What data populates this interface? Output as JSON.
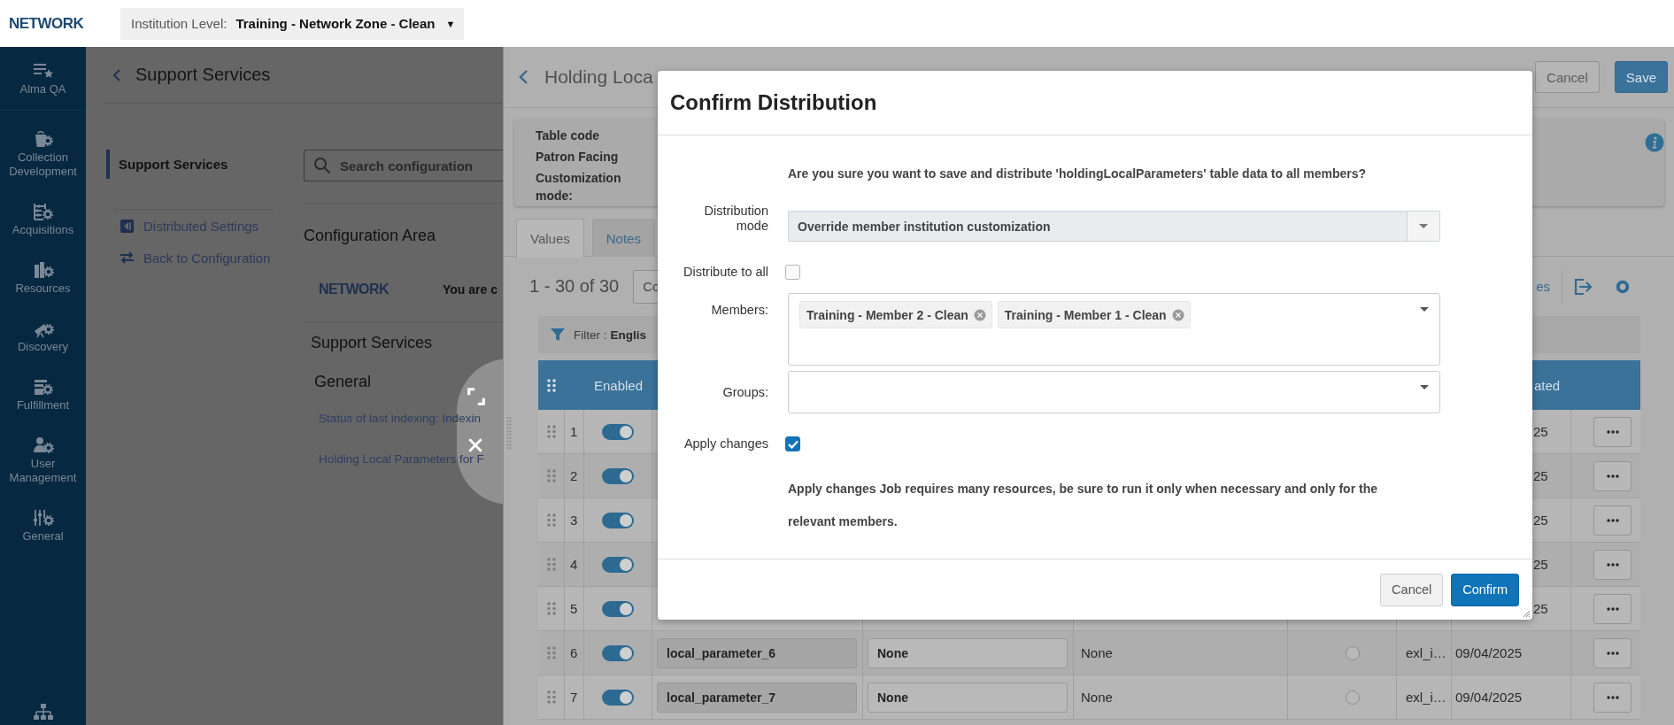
{
  "top_bar": {
    "logo": "NETWORK",
    "institution_label": "Institution Level:",
    "institution_value": "Training - Network Zone - Clean",
    "dropdown_glyph": "▼"
  },
  "nav_rail": {
    "items": [
      {
        "label": "Alma QA"
      },
      {
        "label": "Collection Development"
      },
      {
        "label": "Acquisitions"
      },
      {
        "label": "Resources"
      },
      {
        "label": "Discovery"
      },
      {
        "label": "Fulfillment"
      },
      {
        "label": "User Management"
      },
      {
        "label": "General"
      }
    ]
  },
  "config_panel": {
    "title": "Support Services",
    "side_menu": [
      {
        "label": "Support Services",
        "selected": true
      }
    ],
    "links": [
      "Distributed Settings",
      "Back to Configuration"
    ],
    "search": {
      "placeholder": "Search configuration"
    },
    "area_title": "Configuration Area",
    "zone_logo": "NETWORK",
    "zone_notice": "You are c",
    "section": "Support Services",
    "group": "General",
    "items": [
      "Status of last indexing: Indexin",
      "Holding Local Parameters for F"
    ]
  },
  "detail_page": {
    "title": "Holding Loca",
    "buttons": [
      {
        "label": "Cancel",
        "kind": "secondary"
      },
      {
        "label": "Save",
        "kind": "primary"
      }
    ],
    "info_labels": [
      "Table code",
      "Patron Facing",
      "Customization mode:"
    ],
    "tabs": [
      {
        "label": "Values",
        "selected": true
      },
      {
        "label": "Notes",
        "selected": false
      }
    ],
    "count": "1 - 30 of 30",
    "view_select": "Co",
    "toolbar_link": "es",
    "filter": {
      "label": "Filter :",
      "value": "Englis"
    },
    "table": {
      "columns": [
        "Enabled",
        "ated"
      ],
      "rows": [
        {
          "number": "1",
          "enabled": true,
          "date": "25"
        },
        {
          "number": "2",
          "enabled": true,
          "date": "25"
        },
        {
          "number": "3",
          "enabled": true,
          "date": "25"
        },
        {
          "number": "4",
          "enabled": true,
          "date": "25"
        },
        {
          "number": "5",
          "enabled": true,
          "date": "25"
        },
        {
          "number": "6",
          "enabled": true,
          "code": "local_parameter_6",
          "description": "None",
          "column_6": "None",
          "radio_selected": false,
          "column_8": "exl_i…",
          "date": "09/04/2025"
        },
        {
          "number": "7",
          "enabled": true,
          "code": "local_parameter_7",
          "description": "None",
          "column_6": "None",
          "radio_selected": false,
          "column_8": "exl_i…",
          "date": "09/04/2025"
        }
      ]
    }
  },
  "dialog": {
    "title": "Confirm Distribution",
    "question": "Are you sure you want to save and distribute 'holdingLocalParameters' table data to all members?",
    "fields": [
      {
        "kind": "select",
        "label": "Distribution mode",
        "value": "Override member institution customization"
      },
      {
        "kind": "checkbox",
        "label": "Distribute to all",
        "checked": false
      },
      {
        "kind": "tags",
        "label": "Members:",
        "tags": [
          "Training - Member 2 - Clean",
          "Training - Member 1 - Clean"
        ]
      },
      {
        "kind": "tags",
        "label": "Groups:"
      },
      {
        "kind": "checkbox",
        "label": "Apply changes",
        "checked": true
      }
    ],
    "note": "Apply changes Job requires many resources, be sure to run it only when necessary and only for the relevant members.",
    "buttons": [
      {
        "label": "Cancel",
        "kind": "secondary"
      },
      {
        "label": "Confirm",
        "kind": "primary"
      }
    ]
  }
}
